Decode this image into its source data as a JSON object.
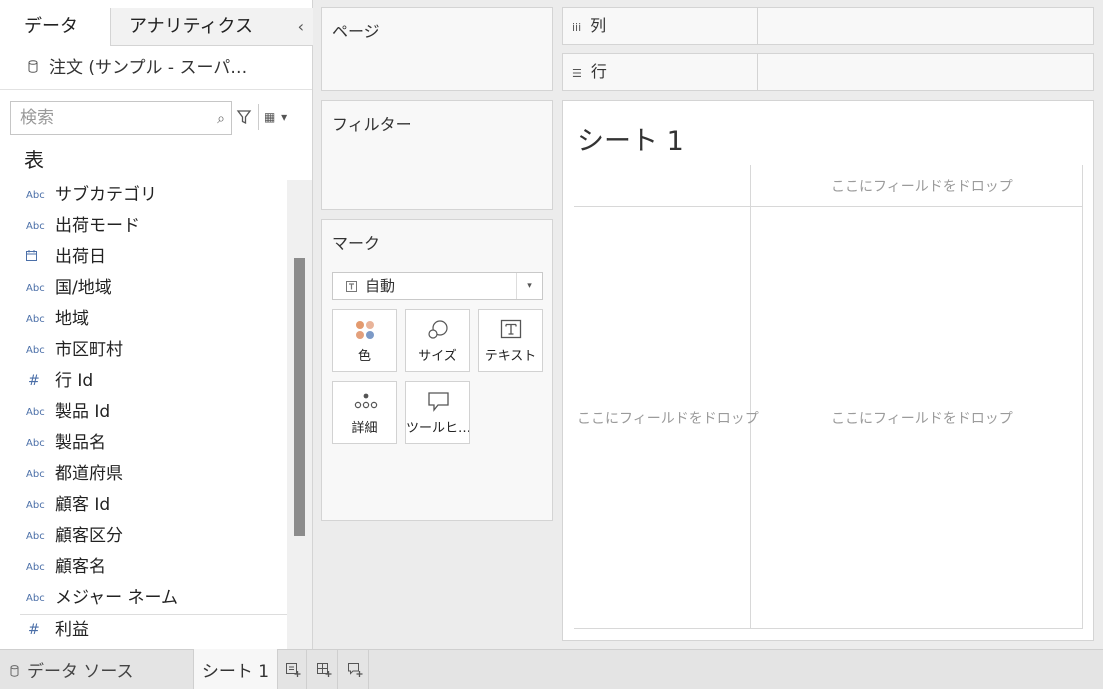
{
  "left_pane": {
    "tabs": {
      "data": "データ",
      "analytics": "アナリティクス"
    },
    "datasource": "注文 (サンプル - スーパーストア)",
    "search_placeholder": "検索",
    "tables_heading": "表",
    "fields": [
      {
        "type": "Abc",
        "name": "サブカテゴリ"
      },
      {
        "type": "Abc",
        "name": "出荷モード"
      },
      {
        "type": "date",
        "name": "出荷日"
      },
      {
        "type": "Abc",
        "name": "国/地域"
      },
      {
        "type": "Abc",
        "name": "地域"
      },
      {
        "type": "Abc",
        "name": "市区町村"
      },
      {
        "type": "#",
        "name": "行 Id"
      },
      {
        "type": "Abc",
        "name": "製品 Id"
      },
      {
        "type": "Abc",
        "name": "製品名"
      },
      {
        "type": "Abc",
        "name": "都道府県"
      },
      {
        "type": "Abc",
        "name": "顧客 Id"
      },
      {
        "type": "Abc",
        "name": "顧客区分"
      },
      {
        "type": "Abc",
        "name": "顧客名"
      },
      {
        "type": "Abc",
        "name": "メジャー ネーム"
      },
      {
        "type": "#",
        "name": "利益"
      }
    ]
  },
  "shelves": {
    "pages": "ページ",
    "filters": "フィルター",
    "marks": "マーク",
    "columns": "列",
    "rows": "行"
  },
  "marks_card": {
    "mark_type": "自動",
    "buttons": {
      "color": "色",
      "size": "サイズ",
      "text": "テキスト",
      "detail": "詳細",
      "tooltip": "ツールヒント"
    }
  },
  "worksheet": {
    "title": "シート 1",
    "drop_hint": "ここにフィールドをドロップ"
  },
  "bottom_tabs": {
    "datasource": "データ ソース",
    "sheet": "シート 1"
  },
  "colors": {
    "color_dots": [
      "#e39a6e",
      "#e9b49a",
      "#4b9ec5",
      "#7c9ac7"
    ]
  }
}
